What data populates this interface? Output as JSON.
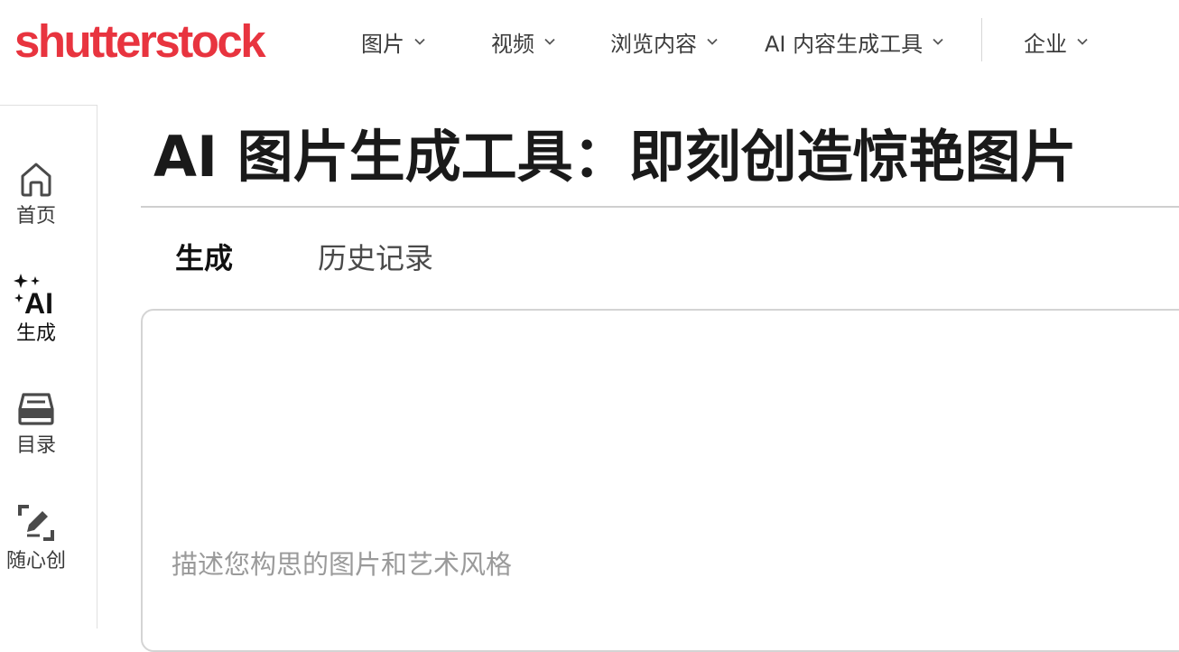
{
  "header": {
    "logo_text": "shutterstock",
    "brand_color": "#e8343f",
    "nav": [
      {
        "label": "图片",
        "icon": "chevron-down-icon"
      },
      {
        "label": "视频",
        "icon": "chevron-down-icon"
      },
      {
        "label": "浏览内容",
        "icon": "chevron-down-icon"
      },
      {
        "label": "AI 内容生成工具",
        "icon": "chevron-down-icon"
      },
      {
        "label": "企业",
        "icon": "chevron-down-icon"
      }
    ]
  },
  "sidebar": {
    "items": [
      {
        "label": "首页",
        "icon": "home-icon"
      },
      {
        "label": "生成",
        "icon": "ai-sparkle-icon",
        "icon_text": "AI",
        "active": true
      },
      {
        "label": "目录",
        "icon": "catalog-tray-icon"
      },
      {
        "label": "随心创",
        "icon": "edit-frame-icon"
      }
    ]
  },
  "main": {
    "title_bold": "AI 图片生成工具：",
    "title_rest": "即刻创造惊艳图片",
    "tabs": [
      {
        "label": "生成",
        "active": true
      },
      {
        "label": "历史记录",
        "active": false
      }
    ],
    "prompt": {
      "value": "",
      "placeholder": "描述您构思的图片和艺术风格"
    }
  }
}
